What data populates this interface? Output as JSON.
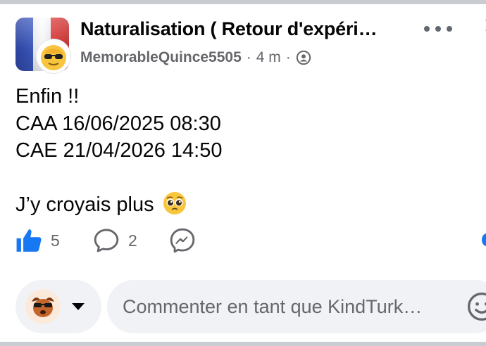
{
  "post": {
    "group_name": "Naturalisation ( Retour d'expéri…",
    "author": "MemorableQuince5505",
    "separator": "·",
    "time": "4 m",
    "lines": [
      "Enfin !!",
      "CAA 16/06/2025 08:30",
      "CAE 21/04/2026 14:50",
      "",
      "J’y croyais plus"
    ],
    "emoji": "pleading-face"
  },
  "actions": {
    "likes": "5",
    "comments": "2"
  },
  "composer": {
    "placeholder": "Commenter en tant que KindTurk…"
  },
  "colors": {
    "accent": "#1877f2",
    "muted": "#65676b",
    "input_bg": "#f0f2f5",
    "flag_blue": "#3c5ac2",
    "flag_red": "#df3a3a"
  },
  "icons": [
    "like-icon",
    "comment-icon",
    "messenger-icon",
    "more-icon",
    "privacy-icon",
    "caret-down-icon",
    "emoji-icon"
  ]
}
